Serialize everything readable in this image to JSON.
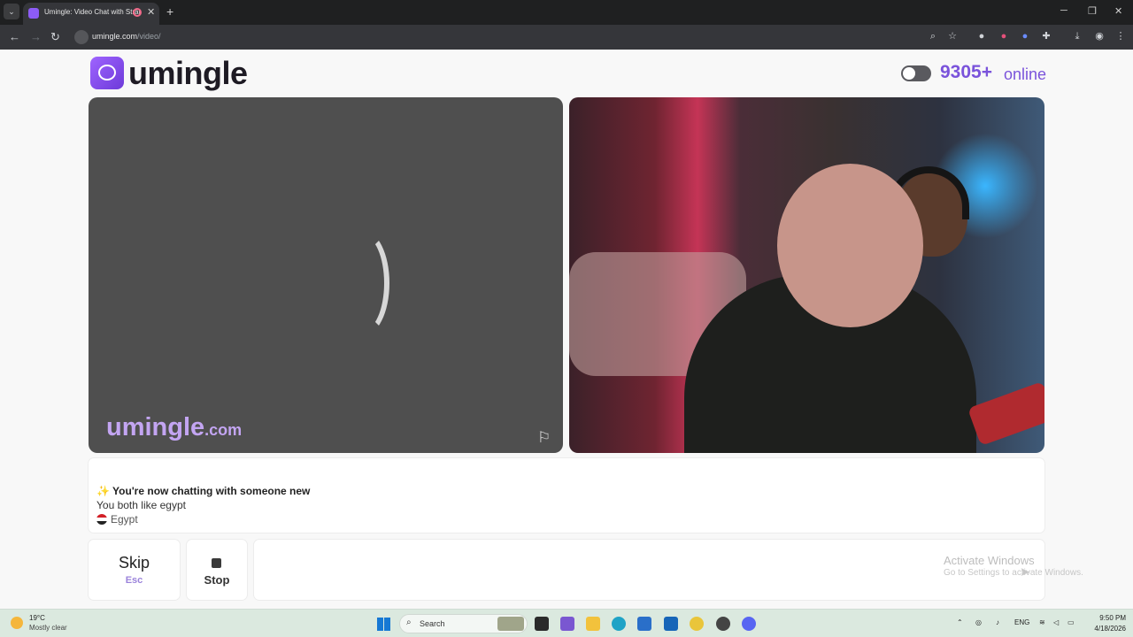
{
  "browser": {
    "tab_title": "Umingle: Video Chat with Strangers",
    "url_host": "umingle.com",
    "url_path": "/video/"
  },
  "header": {
    "logo_text": "umingle",
    "online_count": "9305+",
    "online_label": "online"
  },
  "video": {
    "watermark": "umingle",
    "watermark_suffix": ".com"
  },
  "chat": {
    "messages": [
      "✨ You're now chatting with someone new",
      "You both like egypt",
      "Egypt"
    ]
  },
  "controls": {
    "skip_label": "Skip",
    "skip_key": "Esc",
    "stop_label": "Stop",
    "message_placeholder": ""
  },
  "overlay": {
    "activate_title": "Activate Windows",
    "activate_sub": "Go to Settings to activate Windows."
  },
  "taskbar": {
    "weather_temp": "19°C",
    "weather_desc": "Mostly clear",
    "search_label": "Search",
    "lang": "ENG",
    "time": "9:50 PM",
    "date": "4/18/2026"
  },
  "colors": {
    "brand": "#7a53db",
    "video_bg": "#4f4f4f"
  },
  "icons": [
    "search-icon",
    "star-icon",
    "download-icon",
    "chat-bubble-icon",
    "flag-icon",
    "stop-icon",
    "send-icon"
  ]
}
